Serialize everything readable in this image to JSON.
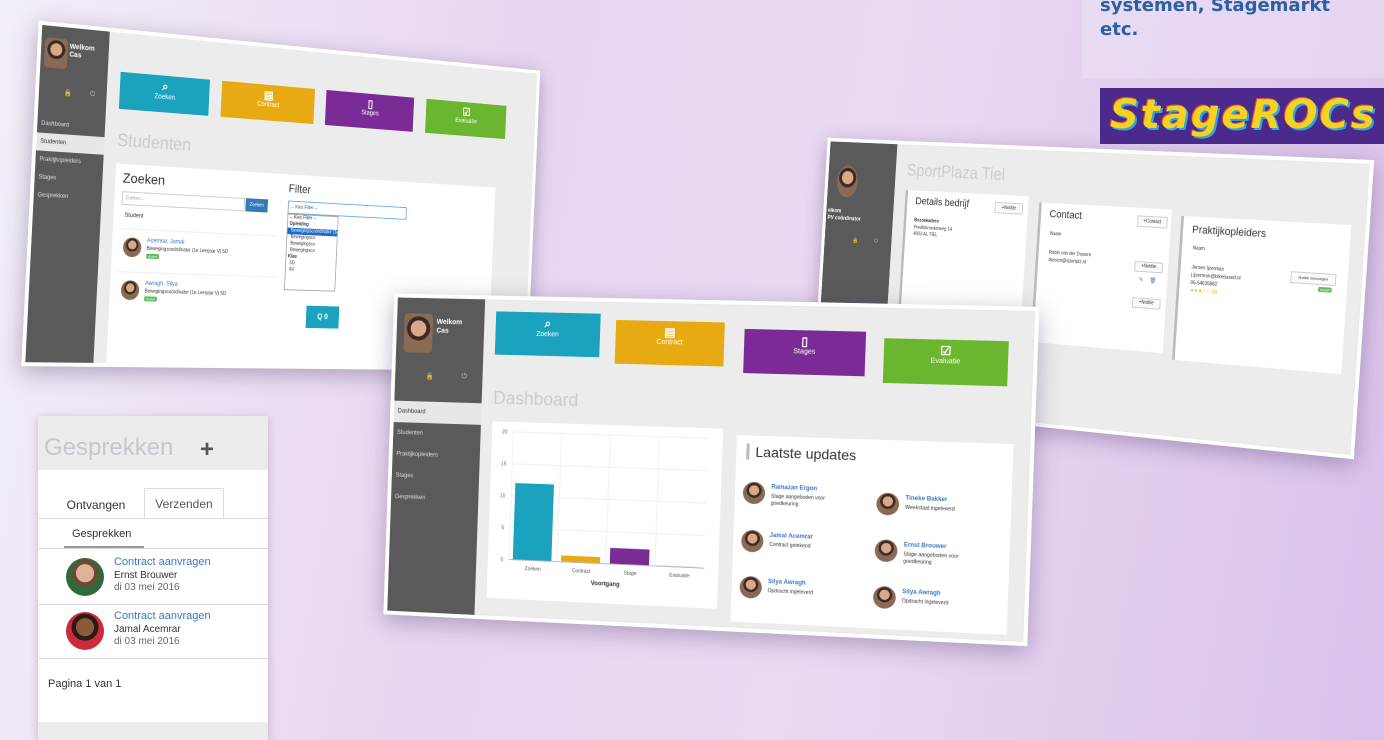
{
  "tagline": {
    "line1": "systemen, Stagemarkt",
    "line2": "etc."
  },
  "logo": {
    "text": "StageROCs",
    "bg": "#4b2a8c",
    "fg": "#f7d21f"
  },
  "tiles": {
    "search": "Zoeken",
    "contract": "Contract",
    "stages": "Stages",
    "evaluation": "Evaluatie"
  },
  "colors": {
    "search": "#1aa2bf",
    "contract": "#e8aa12",
    "stages": "#7a2b96",
    "evaluation": "#6ab62f"
  },
  "nav": {
    "dashboard": "Dashboard",
    "students": "Studenten",
    "trainers": "Praktijkopleiders",
    "stages": "Stages",
    "talks": "Gesprekken"
  },
  "welcome": {
    "line1": "Welkom",
    "line2": "Cas"
  },
  "students": {
    "title": "Studenten",
    "search_heading": "Zoeken",
    "search_placeholder": "Zoeken...",
    "search_button": "Zoeken",
    "filter_heading": "Filter",
    "filter_selected": "-- Kies Filter --",
    "dropdown": [
      "-- Kies Filter --",
      "Opleiding",
      "Bewegingscoördinator (1e Leerjaar V)",
      "Bewegingsco",
      "Bewegingsco",
      "Bewegingsco",
      "Klas",
      "5D",
      "4V"
    ],
    "column": "Student",
    "rows": [
      {
        "name": "Acemrar, Jamal",
        "sub": "Bewegingscoördinator (1e Leerjaar V) 5D",
        "status": "Actief"
      },
      {
        "name": "Awragh, Silya",
        "sub": "Bewegingscoördinator (1e Leerjaar V) 5D",
        "status": "Actief"
      }
    ],
    "search_button2": "Q 0"
  },
  "company": {
    "title": "SportPlaza Tiel",
    "welcome1": "elkom",
    "welcome2": "PV coördinator",
    "details": "Details bedrijf",
    "note": "+Notitie",
    "address_label": "Bezoekadres",
    "address": [
      "Predikbroederweg 14",
      "4003 AL TIEL"
    ],
    "contact": "Contact",
    "add_contact": "+Contact",
    "naam": "Naam",
    "contact_name": "Robin van der Dussen",
    "contact_mail": "dussen@sportplz.nl",
    "trainers": "Praktijkopleiders",
    "trainer_name": "Jeroen Ijzerman",
    "trainer_mail": "j.ijzerman@bikebased.nl",
    "trainer_phone": "06-54635882",
    "trainer_rating": "★★★☆☆ (4)",
    "add_note": "Notitie toevoegen",
    "active": "Actief"
  },
  "dashboard": {
    "title": "Dashboard",
    "updates_title": "Laatste updates",
    "updates_left": [
      {
        "name": "Ramazan Ergon",
        "text": "Stage aangeboden voor goedkeuring"
      },
      {
        "name": "Jamal Acemrar",
        "text": "Contract getekend"
      },
      {
        "name": "Silya Awragh",
        "text": "Opdracht ingeleverd"
      }
    ],
    "updates_right": [
      {
        "name": "Tineke Bakker",
        "text": "Weekstaat ingeleverd"
      },
      {
        "name": "Ernst Brouwer",
        "text": "Stage aangeboden voor goedkeuring"
      },
      {
        "name": "Silya Awragh",
        "text": "Opdracht ingeleverd"
      }
    ]
  },
  "chart_data": {
    "type": "bar",
    "categories": [
      "Zoeken",
      "Contract",
      "Stage",
      "Evaluatie"
    ],
    "values": [
      12,
      1,
      2.5,
      0.1
    ],
    "ylim": [
      0,
      20
    ],
    "yticks": [
      "20",
      "15",
      "10",
      "5",
      "0"
    ],
    "xlabel": "Voortgang",
    "colors": [
      "#1aa2bf",
      "#e8aa12",
      "#7a2b96",
      "#6ab62f"
    ]
  },
  "talks": {
    "title": "Gesprekken",
    "plus": "+",
    "tab_received": "Ontvangen",
    "tab_sent": "Verzenden",
    "subtab": "Gesprekken",
    "items": [
      {
        "subject": "Contract aanvragen",
        "from": "Ernst Brouwer",
        "date": "di 03 mei 2016"
      },
      {
        "subject": "Contract aanvragen",
        "from": "Jamal Acemrar",
        "date": "di 03 mei 2016"
      }
    ],
    "pagination": "Pagina 1 van 1"
  }
}
